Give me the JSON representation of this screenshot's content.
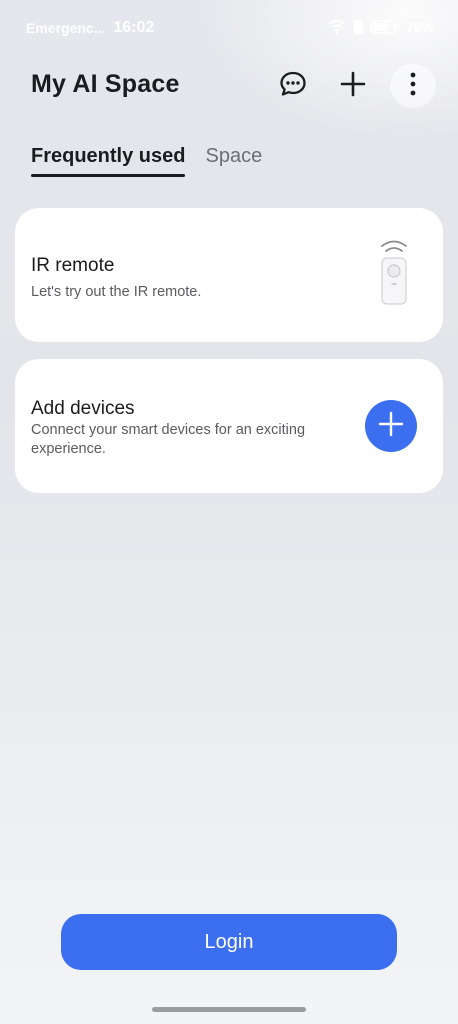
{
  "status_bar": {
    "carrier": "Emergenc...",
    "time": "16:02",
    "battery": "76%",
    "icons": [
      "wifi-icon",
      "sim-icon",
      "battery-icon"
    ]
  },
  "header": {
    "title": "My AI Space",
    "actions": [
      "chat-bubble-icon",
      "plus-icon",
      "more-vertical-icon"
    ]
  },
  "tabs": [
    {
      "label": "Frequently used",
      "active": true
    },
    {
      "label": "Space",
      "active": false
    }
  ],
  "cards": {
    "ir_remote": {
      "title": "IR remote",
      "subtitle": "Let's try out the IR remote.",
      "icon": "ir-remote-icon"
    },
    "add_devices": {
      "title": "Add devices",
      "subtitle": "Connect your smart devices for an exciting experience.",
      "icon": "plus-icon"
    }
  },
  "login": {
    "label": "Login"
  },
  "colors": {
    "accent": "#3b6ff0",
    "card": "#ffffff",
    "text": "#1b1c20",
    "subtext": "#5a5b60"
  }
}
